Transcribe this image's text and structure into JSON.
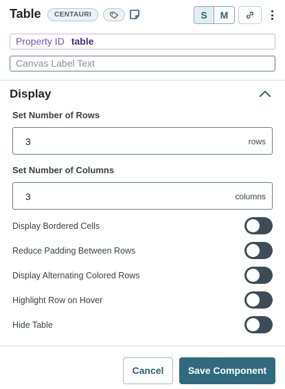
{
  "header": {
    "title": "Table",
    "badge": "CENTAURI",
    "tag_icon": "tag-icon",
    "note_icon": "note-icon",
    "size_options": [
      "S",
      "M"
    ],
    "selected_size": "S",
    "link_icon": "link-icon",
    "more_icon": "kebab-menu-icon"
  },
  "property": {
    "label": "Property ID",
    "value": "table"
  },
  "canvas_label": {
    "placeholder": "Canvas Label Text",
    "value": ""
  },
  "display": {
    "title": "Display",
    "rows": {
      "label": "Set Number of Rows",
      "value": "3",
      "unit": "rows"
    },
    "columns": {
      "label": "Set Number of Columns",
      "value": "3",
      "unit": "columns"
    },
    "toggles": [
      {
        "label": "Display Bordered Cells",
        "on": false
      },
      {
        "label": "Reduce Padding Between Rows",
        "on": false
      },
      {
        "label": "Display Alternating Colored Rows",
        "on": false
      },
      {
        "label": "Highlight Row on Hover",
        "on": false
      },
      {
        "label": "Hide Table",
        "on": false
      }
    ]
  },
  "footer": {
    "cancel_label": "Cancel",
    "save_label": "Save Component"
  },
  "colors": {
    "accent": "#2f6a7f",
    "toggle_off": "#3d4c56",
    "property_border": "#c9b6e8"
  }
}
